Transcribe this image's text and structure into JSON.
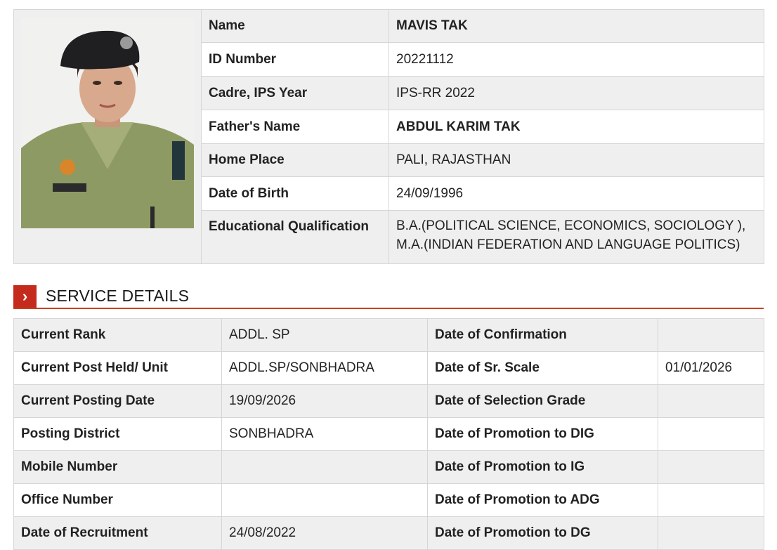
{
  "profile": {
    "rows": [
      {
        "label": "Name",
        "value": "MAVIS TAK"
      },
      {
        "label": "ID Number",
        "value": "20221112"
      },
      {
        "label": "Cadre, IPS Year",
        "value": "IPS-RR 2022"
      },
      {
        "label": "Father's Name",
        "value": "ABDUL KARIM TAK"
      },
      {
        "label": "Home Place",
        "value": "PALI, RAJASTHAN"
      },
      {
        "label": "Date of Birth",
        "value": "24/09/1996"
      },
      {
        "label": "Educational Qualification",
        "value_line1": "B.A.(POLITICAL SCIENCE, ECONOMICS, SOCIOLOGY ),",
        "value_line2": "M.A.(INDIAN FEDERATION AND LANGUAGE POLITICS)"
      }
    ]
  },
  "service": {
    "heading": "SERVICE DETAILS",
    "icon": "chevron-right-icon",
    "rows": [
      {
        "label1": "Current Rank",
        "value1": "ADDL. SP",
        "label2": "Date of Confirmation",
        "value2": ""
      },
      {
        "label1": "Current Post Held/ Unit",
        "value1": "ADDL.SP/SONBHADRA",
        "label2": "Date of Sr. Scale",
        "value2": "01/01/2026"
      },
      {
        "label1": "Current Posting Date",
        "value1": "19/09/2026",
        "label2": "Date of Selection Grade",
        "value2": ""
      },
      {
        "label1": "Posting District",
        "value1": "SONBHADRA",
        "label2": "Date of Promotion to DIG",
        "value2": ""
      },
      {
        "label1": "Mobile Number",
        "value1": "",
        "label2": "Date of Promotion to IG",
        "value2": ""
      },
      {
        "label1": "Office Number",
        "value1": "",
        "label2": "Date of Promotion to ADG",
        "value2": ""
      },
      {
        "label1": "Date of Recruitment",
        "value1": "24/08/2022",
        "label2": "Date of Promotion to DG",
        "value2": ""
      }
    ]
  },
  "colors": {
    "accent": "#c42b1c",
    "row_shade": "#efefef",
    "border": "#d6d6d6"
  }
}
